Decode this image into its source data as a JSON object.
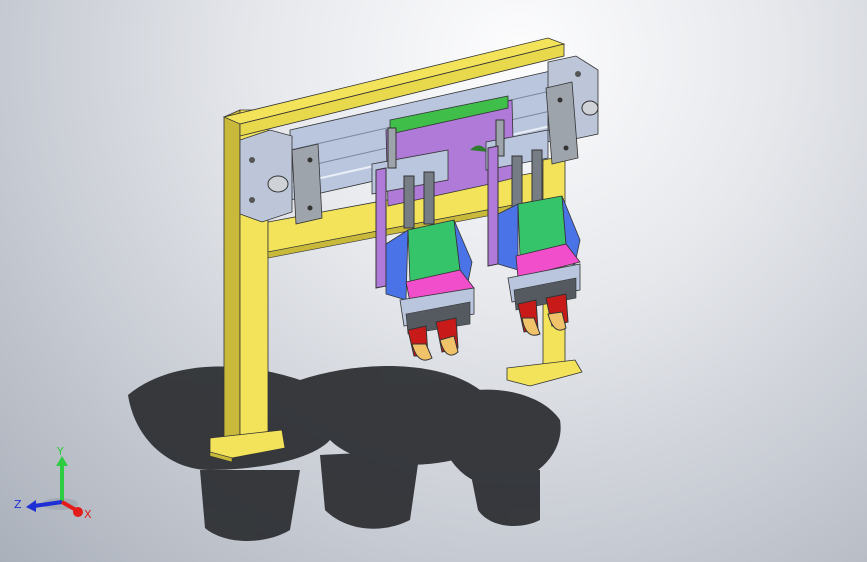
{
  "viewport": {
    "background_top": "#fdfdfe",
    "background_bottom": "#aab0ba"
  },
  "model": {
    "colors": {
      "frame": "#f2e35a",
      "frame_shade": "#c9b93b",
      "rail": "#b9c6de",
      "plate": "#b07ad8",
      "guide": "#3fbf4a",
      "body_green": "#35c46a",
      "body_blue": "#4b73e8",
      "body_magenta": "#f04ecb",
      "finger": "#c91a1a",
      "finger_tip": "#f0c36a",
      "metal": "#9ea4ab",
      "shadow": "#2a2c30"
    }
  },
  "triad": {
    "labels": {
      "y": "Y",
      "z": "Z",
      "x": "X"
    },
    "colors": {
      "y": "#2ecc40",
      "z": "#1f2fd6",
      "x": "#e21b1b"
    }
  }
}
